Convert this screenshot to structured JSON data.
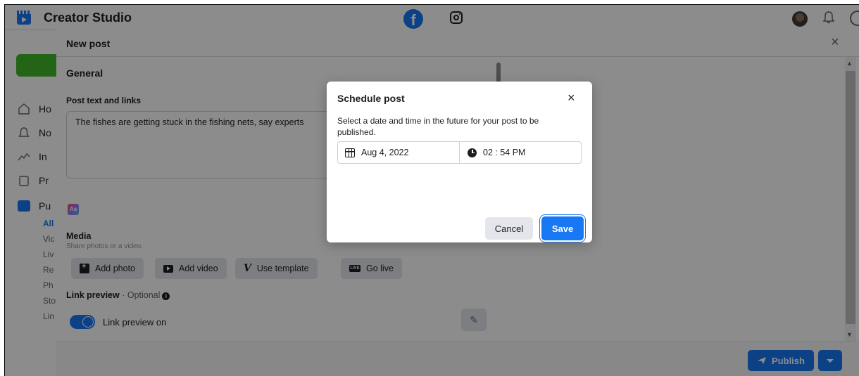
{
  "app": {
    "title": "Creator Studio"
  },
  "sidebar": {
    "items": [
      {
        "label": "Ho",
        "icon": "home-icon"
      },
      {
        "label": "No",
        "icon": "bell-icon"
      },
      {
        "label": "In",
        "icon": "insights-icon"
      },
      {
        "label": "Pr",
        "icon": "clipboard-icon"
      },
      {
        "label": "Pu",
        "icon": "publishing-icon"
      }
    ],
    "subitems": [
      "All",
      "Vic",
      "Liv",
      "Re",
      "Ph",
      "Sto",
      "Lin"
    ]
  },
  "new_post": {
    "title": "New post",
    "general_heading": "General",
    "post_text_label": "Post text and links",
    "post_text_value": "The fishes are getting stuck in the fishing nets, say experts",
    "media": {
      "title": "Media",
      "subtitle": "Share photos or a video.",
      "buttons": {
        "add_photo": "Add photo",
        "add_video": "Add video",
        "use_template": "Use template",
        "go_live": "Go live"
      },
      "live_icon_text": "LIVE"
    },
    "link_preview": {
      "title": "Link preview",
      "optional": " · Optional",
      "toggle_label": "Link preview on",
      "toggle_on": true
    },
    "publish_label": "Publish",
    "close_symbol": "×"
  },
  "schedule_modal": {
    "title": "Schedule post",
    "description": "Select a date and time in the future for your post to be published.",
    "date": "Aug 4, 2022",
    "time": "02 : 54 PM",
    "cancel_label": "Cancel",
    "save_label": "Save",
    "close_symbol": "×"
  },
  "colors": {
    "brand_blue": "#1877f2",
    "create_green": "#42b72a",
    "overlay": "rgba(0,0,0,0.45)"
  }
}
